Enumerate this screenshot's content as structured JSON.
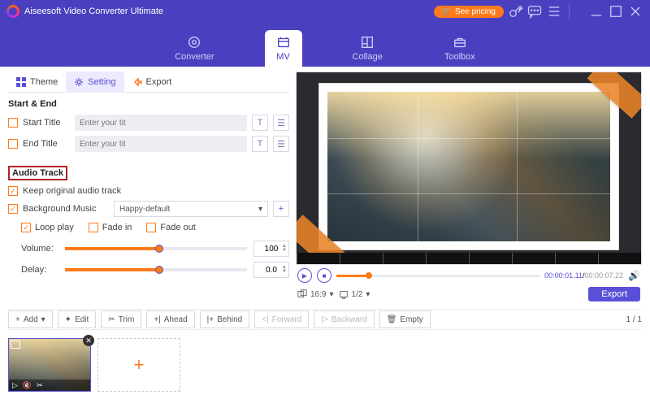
{
  "titlebar": {
    "title": "Aiseesoft Video Converter Ultimate",
    "pricing": "See pricing"
  },
  "modes": {
    "converter": "Converter",
    "mv": "MV",
    "collage": "Collage",
    "toolbox": "Toolbox"
  },
  "lp_tabs": {
    "theme": "Theme",
    "setting": "Setting",
    "export": "Export"
  },
  "start_end": {
    "title": "Start & End",
    "start_label": "Start Title",
    "end_label": "End Title",
    "placeholder": "Enter your tit"
  },
  "audio": {
    "title": "Audio Track",
    "keep": "Keep original audio track",
    "bgm": "Background Music",
    "bgm_value": "Happy-default",
    "loop": "Loop play",
    "fadein": "Fade in",
    "fadeout": "Fade out",
    "volume_label": "Volume:",
    "volume_value": "100",
    "delay_label": "Delay:",
    "delay_value": "0.0"
  },
  "preview": {
    "time_current": "00:00:01.11",
    "time_total": "00:00:07.22",
    "aspect": "16:9",
    "page": "1/2",
    "export": "Export"
  },
  "toolbar": {
    "add": "Add",
    "edit": "Edit",
    "trim": "Trim",
    "ahead": "Ahead",
    "behind": "Behind",
    "forward": "Forward",
    "backward": "Backward",
    "empty": "Empty",
    "page": "1 / 1"
  }
}
